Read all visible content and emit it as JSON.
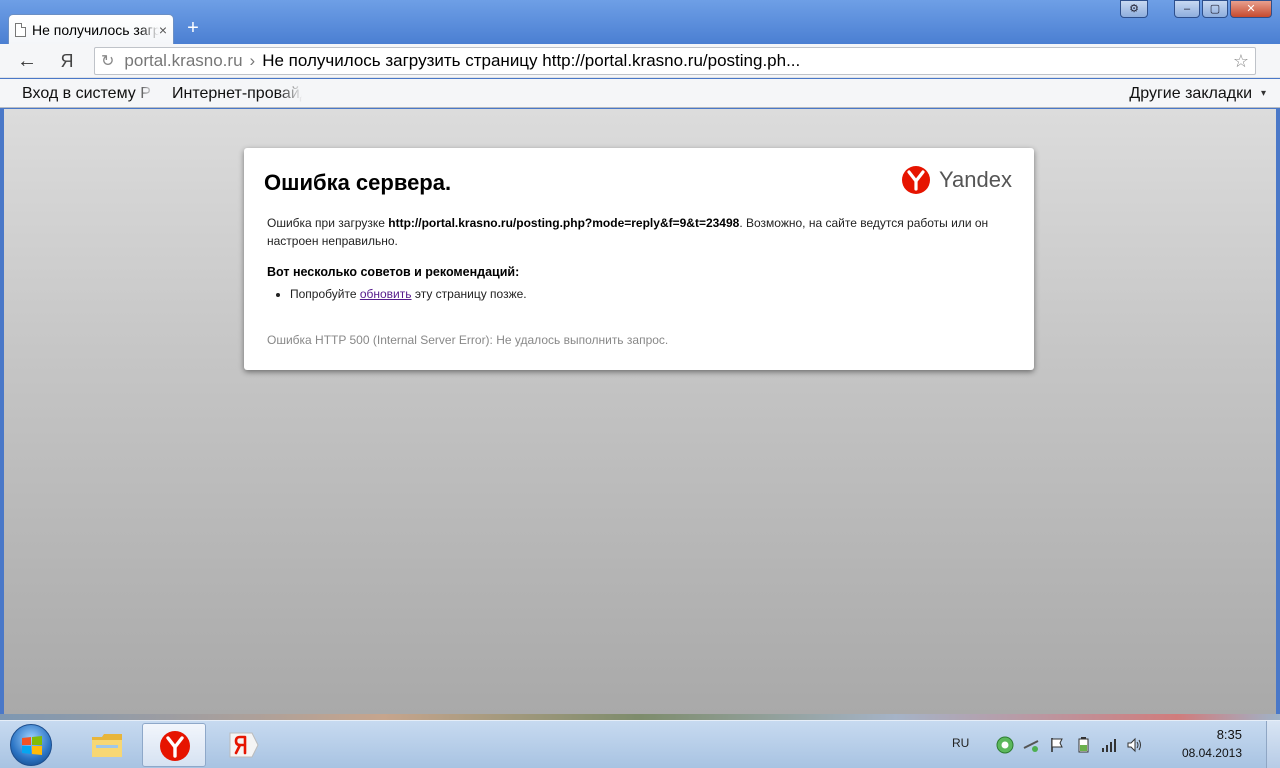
{
  "browser": {
    "tab": {
      "title": "Не получилось загрузить страницу",
      "close_glyph": "×"
    },
    "new_tab_glyph": "+",
    "window_controls": {
      "settings": "⚙",
      "minimize": "–",
      "maximize": "▢",
      "close": "✕"
    },
    "toolbar": {
      "back_glyph": "←",
      "yandex_button": "Я",
      "omnibox": {
        "reload_glyph": "↻",
        "host": "portal.krasno.ru",
        "separator": "›",
        "title": "Не получилось загрузить страницу http://portal.krasno.ru/posting.ph...",
        "star_glyph": "☆"
      }
    },
    "bookmarks": {
      "items": [
        {
          "label": "Вход в систему Р"
        },
        {
          "label": "Интернет-провайдер"
        }
      ],
      "other_label": "Другие закладки",
      "other_arrow": "▾"
    }
  },
  "error_page": {
    "title": "Ошибка сервера.",
    "logo_text": "Yandex",
    "description": {
      "prefix": "Ошибка при загрузке ",
      "url": "http://portal.krasno.ru/posting.php?mode=reply&f=9&t=23498",
      "suffix": ". Возможно, на сайте ведутся работы или он настроен неправильно."
    },
    "tips_heading": "Вот несколько советов и рекомендаций:",
    "tip": {
      "prefix": "Попробуйте ",
      "link": "обновить",
      "suffix": " эту страницу позже."
    },
    "error_detail": "Ошибка HTTP 500 (Internal Server Error): Не удалось выполнить запрос."
  },
  "taskbar": {
    "tray": {
      "language": "RU"
    },
    "clock": {
      "time": "8:35",
      "date": "08.04.2013"
    }
  },
  "colors": {
    "yandex_red": "#e61400",
    "link_visited": "#551a8b",
    "content_bg_top": "#dcdcdc",
    "content_bg_bottom": "#a9a9a9"
  }
}
